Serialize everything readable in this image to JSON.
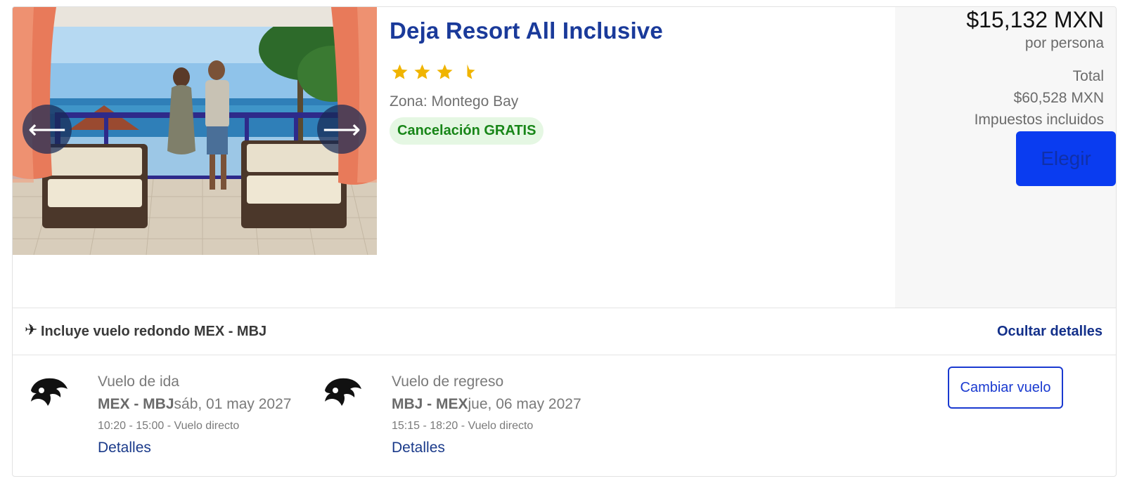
{
  "hotel": {
    "name": "Deja Resort All Inclusive",
    "rating": 3.5,
    "zone": "Zona: Montego Bay",
    "cancellation_badge": "Cancelación GRATIS"
  },
  "gallery": {
    "prev_icon": "arrow-left-icon",
    "next_icon": "arrow-right-icon",
    "prev_glyph": "⟵",
    "next_glyph": "⟶"
  },
  "price": {
    "per_person_amount": "$15,132 MXN",
    "per_person_label": "por persona",
    "total_label": "Total",
    "total_amount": "$60,528 MXN",
    "taxes_note": "Impuestos incluidos",
    "choose_button": "Elegir"
  },
  "flight_summary": {
    "plane_glyph": "✈",
    "includes_text": "Incluye vuelo redondo MEX - MBJ",
    "toggle_label": "Ocultar detalles"
  },
  "flights": {
    "outbound": {
      "title": "Vuelo de ida",
      "route": "MEX - MBJ",
      "date": "sáb, 01 may 2027",
      "times": "10:20 - 15:00 - Vuelo directo",
      "details_link": "Detalles"
    },
    "return": {
      "title": "Vuelo de regreso",
      "route": "MBJ - MEX",
      "date": "jue, 06 may 2027",
      "times": "15:15 - 18:20 - Vuelo directo",
      "details_link": "Detalles"
    },
    "change_button": "Cambiar vuelo"
  },
  "colors": {
    "title_blue": "#1a3a9a",
    "star_gold": "#f0b400",
    "cancel_green": "#188618",
    "cancel_bg": "#e5f7e3",
    "choose_button_bg": "#0a3cf0",
    "link_blue": "#13308a"
  }
}
